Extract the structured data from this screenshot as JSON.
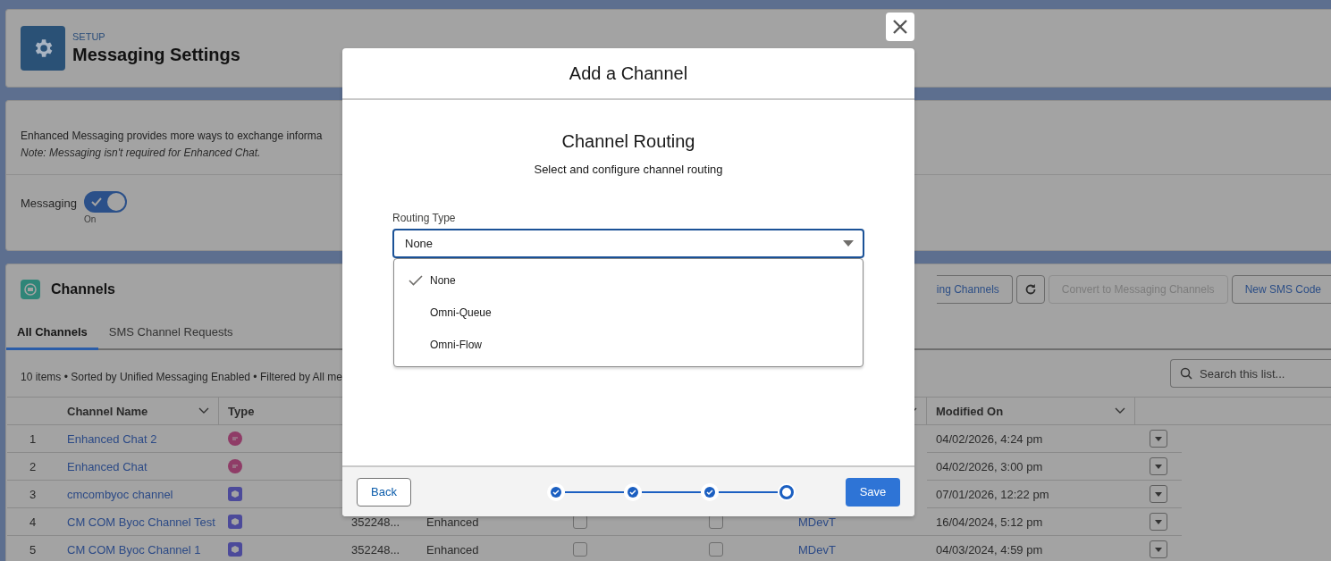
{
  "page_header": {
    "eyebrow": "SETUP",
    "title": "Messaging Settings"
  },
  "intro": {
    "text": "Enhanced Messaging provides more ways to exchange informa",
    "note": "Note: Messaging isn't required for Enhanced Chat.",
    "toggle": {
      "label": "Messaging",
      "on": true,
      "state_text": "On"
    }
  },
  "channels": {
    "title": "Channels",
    "actions": [
      {
        "kind": "text",
        "label": "ing Channels",
        "disabled": false
      },
      {
        "kind": "refresh",
        "disabled": false
      },
      {
        "kind": "text",
        "label": "Convert to Messaging Channels",
        "disabled": true
      },
      {
        "kind": "text",
        "label": "New SMS Code",
        "disabled": false
      }
    ],
    "tabs": [
      {
        "label": "All Channels",
        "selected": true
      },
      {
        "label": "SMS Channel Requests",
        "selected": false
      }
    ],
    "summary": "10 items • Sorted by Unified Messaging Enabled • Filtered by All me",
    "search": {
      "placeholder": "Search this list..."
    },
    "table": {
      "columns": [
        "Channel Name",
        "Type",
        "Modified On"
      ],
      "rows": [
        {
          "number": "1",
          "name": "Enhanced Chat 2",
          "kind": "chat",
          "modified": "04/02/2026, 4:24 pm"
        },
        {
          "number": "2",
          "name": "Enhanced Chat",
          "kind": "chat",
          "modified": "04/02/2026, 3:00 pm"
        },
        {
          "number": "3",
          "name": "cmcombyoc channel",
          "kind": "byoc",
          "modified": "07/01/2026, 12:22 pm"
        },
        {
          "number": "4",
          "name": "CM COM Byoc Channel Test",
          "kind": "byoc",
          "column_4": "352248...",
          "column_5": "Enhanced",
          "column_6_checked": false,
          "column_7_checked": false,
          "column_8": "MDevT",
          "modified": "16/04/2024, 5:12 pm"
        },
        {
          "number": "5",
          "name": "CM COM Byoc Channel 1",
          "kind": "byoc",
          "column_4": "352248...",
          "column_5": "Enhanced",
          "column_6_checked": false,
          "column_7_checked": false,
          "column_8": "MDevT",
          "modified": "04/03/2024, 4:59 pm"
        }
      ]
    }
  },
  "modal": {
    "title": "Add a Channel",
    "heading": "Channel Routing",
    "subtitle": "Select and configure channel routing",
    "field": {
      "label": "Routing Type",
      "value": "None",
      "expanded": true,
      "options": [
        {
          "label": "None",
          "selected": true
        },
        {
          "label": "Omni-Queue",
          "selected": false
        },
        {
          "label": "Omni-Flow",
          "selected": false
        }
      ]
    },
    "back": "Back",
    "save": "Save",
    "steps": [
      {
        "completed": true
      },
      {
        "completed": true
      },
      {
        "completed": true
      },
      {
        "completed": false
      }
    ]
  }
}
